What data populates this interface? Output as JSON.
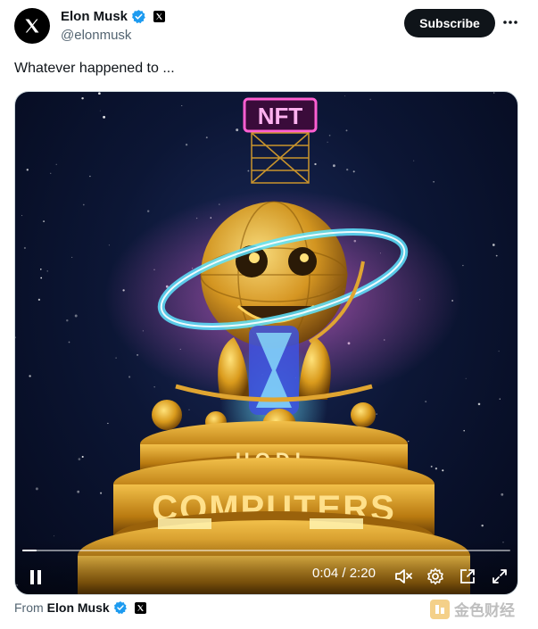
{
  "author": {
    "name": "Elon Musk",
    "handle": "@elonmusk",
    "verified": true,
    "affiliation_icon": "x-logo-icon"
  },
  "header": {
    "subscribe_label": "Subscribe",
    "more_icon": "more-dots-icon"
  },
  "tweet": {
    "text": "Whatever happened to ..."
  },
  "video": {
    "overlay_sign": "NFT",
    "ring_text": "HODL",
    "base_text": "COMPUTERS",
    "current_time": "0:04",
    "separator": "/",
    "duration": "2:20",
    "progress_fraction": 0.03,
    "icons": [
      "pause-icon",
      "mute-icon",
      "settings-gear-icon",
      "pip-icon",
      "fullscreen-icon"
    ]
  },
  "footer": {
    "from_label": "From",
    "from_name": "Elon Musk"
  },
  "watermark": {
    "text": "金色财经"
  },
  "colors": {
    "text_primary": "#0f1419",
    "text_secondary": "#536471",
    "verified_blue": "#1d9bf0",
    "gold": "#e8b33a",
    "neon_pink": "#ff4fd8",
    "neon_cyan": "#4ed8ff"
  }
}
